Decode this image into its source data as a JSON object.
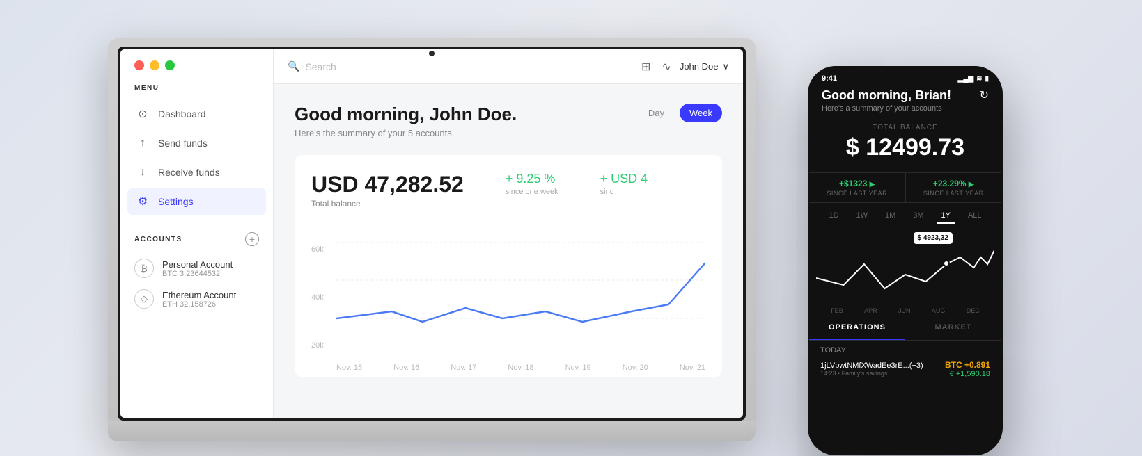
{
  "page": {
    "background": "#dde3ed"
  },
  "laptop": {
    "traffic_lights": [
      "red",
      "yellow",
      "green"
    ],
    "topbar": {
      "search_placeholder": "Search",
      "user_name": "John Doe"
    },
    "sidebar": {
      "menu_label": "MENU",
      "nav_items": [
        {
          "id": "dashboard",
          "label": "Dashboard",
          "icon": "clock",
          "active": false
        },
        {
          "id": "send",
          "label": "Send funds",
          "icon": "arrow-up",
          "active": false
        },
        {
          "id": "receive",
          "label": "Receive funds",
          "icon": "arrow-down",
          "active": false
        },
        {
          "id": "settings",
          "label": "Settings",
          "icon": "gear",
          "active": true
        }
      ],
      "accounts_label": "ACCOUNTS",
      "accounts": [
        {
          "name": "Personal Account",
          "sub": "BTC 3.23644532",
          "icon": "btc"
        },
        {
          "name": "Ethereum Account",
          "sub": "ETH 32.158726",
          "icon": "eth"
        }
      ]
    },
    "dashboard": {
      "greeting": "Good morning, John Doe.",
      "subtitle": "Here's the summary of your 5 accounts.",
      "period_day": "Day",
      "period_week": "Week",
      "balance": "USD 47,282.52",
      "balance_label": "Total balance",
      "stat1_value": "+ 9.25 %",
      "stat1_label": "since one week",
      "stat2_value": "+ USD 4",
      "stat2_label": "sinc",
      "chart_y_labels": [
        "60k",
        "40k",
        "20k"
      ],
      "chart_x_labels": [
        "Nov. 15",
        "Nov. 16",
        "Nov. 17",
        "Nov. 18",
        "Nov. 19",
        "Nov. 20",
        "Nov. 21"
      ]
    }
  },
  "phone": {
    "status_time": "9:41",
    "greeting": "Good morning, Brian!",
    "greeting_sub": "Here's a summary of your accounts",
    "balance_label": "TOTAL BALANCE",
    "balance": "$ 12499.73",
    "stat1_value": "+$1323",
    "stat1_label": "SINCE LAST YEAR",
    "stat2_value": "+23.29%",
    "stat2_label": "SINCE LAST YEAR",
    "period_tabs": [
      "1D",
      "1W",
      "1M",
      "3M",
      "1Y",
      "ALL"
    ],
    "active_period": "1Y",
    "tooltip_value": "$ 4923,32",
    "chart_x_labels": [
      "FEB",
      "APR",
      "JUN",
      "AUG",
      "DEC"
    ],
    "tab_operations": "OPERATIONS",
    "tab_market": "MARKET",
    "today_label": "TODAY",
    "op_hash": "1jLVpwtNMfXWadEe3rE...(+3)",
    "op_sub": "14:23 • Family's savings",
    "op_coin": "BTC +0.891",
    "op_value": "€ +1,590.18"
  }
}
